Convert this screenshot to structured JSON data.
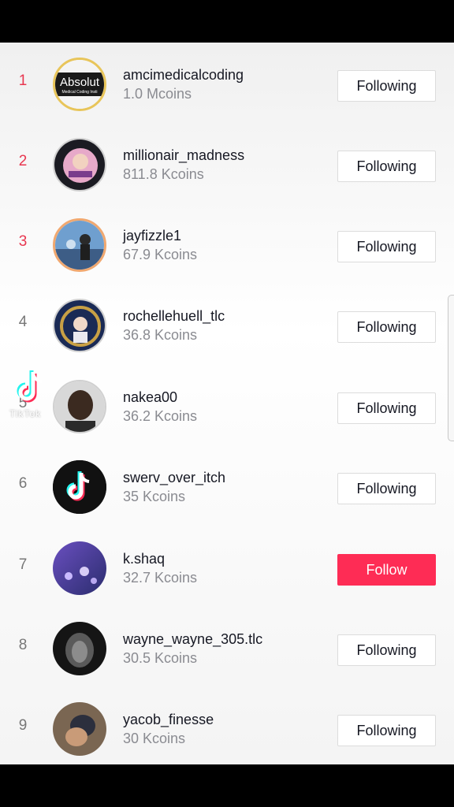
{
  "leaderboard": [
    {
      "rank": "1",
      "name": "amcimedicalcoding",
      "coins": "1.0 Mcoins",
      "button": "Following",
      "avatar_text": "Absolut",
      "avatar_subtext": "Medical Coding Insti"
    },
    {
      "rank": "2",
      "name": "millionair_madness",
      "coins": "811.8 Kcoins",
      "button": "Following"
    },
    {
      "rank": "3",
      "name": "jayfizzle1",
      "coins": "67.9 Kcoins",
      "button": "Following"
    },
    {
      "rank": "4",
      "name": "rochellehuell_tlc",
      "coins": "36.8 Kcoins",
      "button": "Following"
    },
    {
      "rank": "5",
      "name": "nakea00",
      "coins": "36.2 Kcoins",
      "button": "Following"
    },
    {
      "rank": "6",
      "name": "swerv_over_itch",
      "coins": "35 Kcoins",
      "button": "Following"
    },
    {
      "rank": "7",
      "name": "k.shaq",
      "coins": "32.7 Kcoins",
      "button": "Follow"
    },
    {
      "rank": "8",
      "name": "wayne_wayne_305.tlc",
      "coins": "30.5 Kcoins",
      "button": "Following"
    },
    {
      "rank": "9",
      "name": "yacob_finesse",
      "coins": "30 Kcoins",
      "button": "Following"
    }
  ],
  "watermark": {
    "label": "TikTok"
  },
  "colors": {
    "accent": "#fe2c55",
    "top_rank": "#e8364f",
    "muted": "#8a8b91"
  },
  "icons": {
    "watermark": "tiktok-logo-icon",
    "avatar_6": "tiktok-logo-icon"
  }
}
